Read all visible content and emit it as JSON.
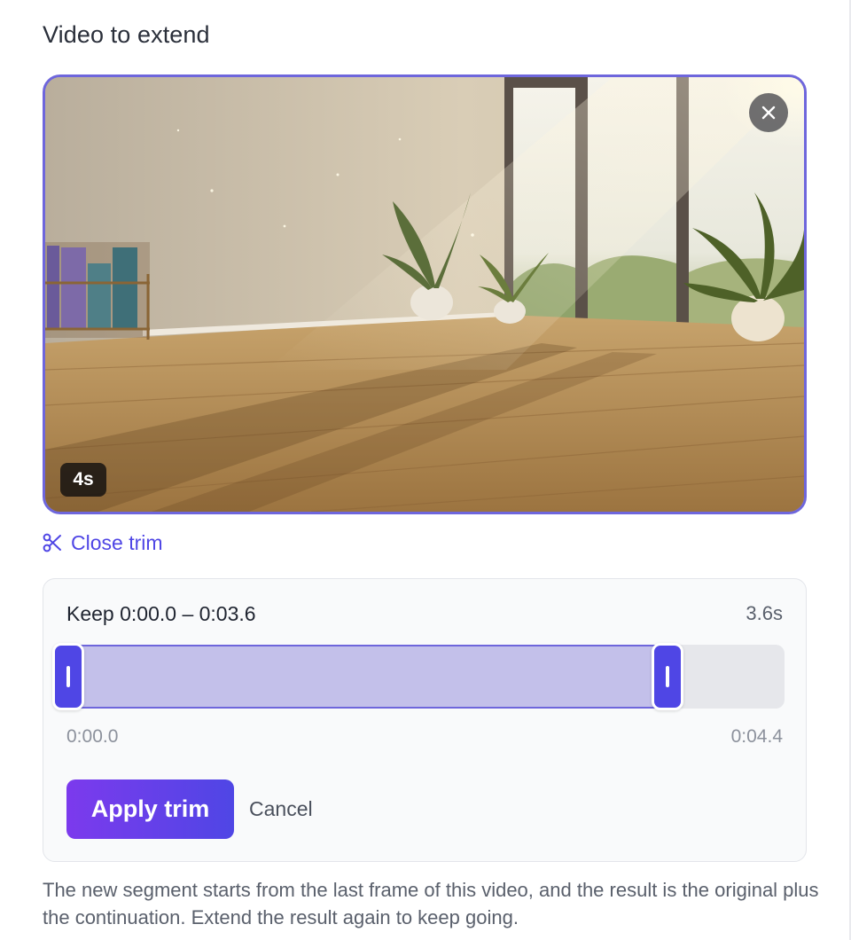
{
  "section": {
    "title": "Video to extend"
  },
  "video": {
    "duration_badge": "4s",
    "close_icon": "close-icon",
    "scene_description_icon": "video-thumbnail"
  },
  "trim_toggle": {
    "label": "Close trim",
    "icon": "scissors-icon"
  },
  "trim": {
    "keep_label": "Keep 0:00.0 – 0:03.6",
    "keep_duration": "3.6s",
    "start_label": "0:00.0",
    "end_label": "0:04.4",
    "selection_start_fraction": 0.0,
    "selection_end_fraction": 0.818,
    "apply_label": "Apply trim",
    "cancel_label": "Cancel"
  },
  "helper": {
    "text": "The new segment starts from the last frame of this video, and the result is the original plus the continuation. Extend the result again to keep going."
  },
  "colors": {
    "accent": "#4f46e5",
    "accent_gradient_start": "#7c3aed",
    "selection_fill": "#c3c0ea",
    "track_bg": "#e6e7eb"
  }
}
